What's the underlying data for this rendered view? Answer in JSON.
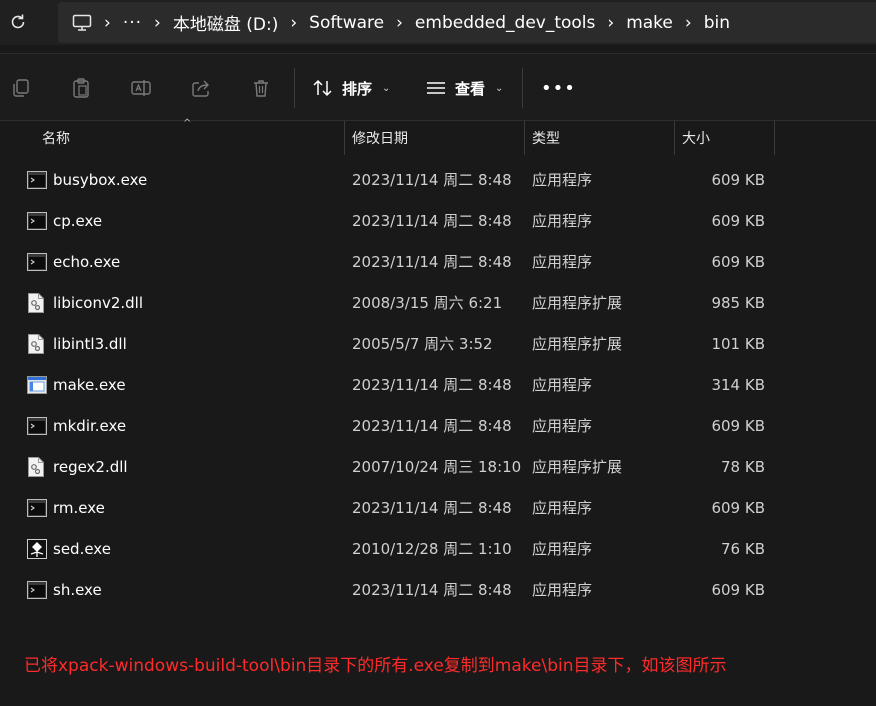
{
  "address_bar": {
    "refresh_icon": "refresh-icon",
    "pc_icon": "this-pc-icon",
    "overflow": "···",
    "crumbs": [
      "本地磁盘 (D:)",
      "Software",
      "embedded_dev_tools",
      "make",
      "bin"
    ]
  },
  "toolbar": {
    "icons": [
      "copy-icon",
      "paste-icon",
      "rename-icon",
      "share-icon",
      "delete-icon"
    ],
    "sort_label": "排序",
    "view_label": "查看",
    "more": "•••"
  },
  "columns": {
    "name": "名称",
    "date": "修改日期",
    "type": "类型",
    "size": "大小"
  },
  "files": [
    {
      "name": "busybox.exe",
      "date": "2023/11/14 周二 8:48",
      "type": "应用程序",
      "size": "609 KB",
      "icon": "console-exe-icon"
    },
    {
      "name": "cp.exe",
      "date": "2023/11/14 周二 8:48",
      "type": "应用程序",
      "size": "609 KB",
      "icon": "console-exe-icon"
    },
    {
      "name": "echo.exe",
      "date": "2023/11/14 周二 8:48",
      "type": "应用程序",
      "size": "609 KB",
      "icon": "console-exe-icon"
    },
    {
      "name": "libiconv2.dll",
      "date": "2008/3/15 周六 6:21",
      "type": "应用程序扩展",
      "size": "985 KB",
      "icon": "dll-file-icon"
    },
    {
      "name": "libintl3.dll",
      "date": "2005/5/7 周六 3:52",
      "type": "应用程序扩展",
      "size": "101 KB",
      "icon": "dll-file-icon"
    },
    {
      "name": "make.exe",
      "date": "2023/11/14 周二 8:48",
      "type": "应用程序",
      "size": "314 KB",
      "icon": "window-exe-icon"
    },
    {
      "name": "mkdir.exe",
      "date": "2023/11/14 周二 8:48",
      "type": "应用程序",
      "size": "609 KB",
      "icon": "console-exe-icon"
    },
    {
      "name": "regex2.dll",
      "date": "2007/10/24 周三 18:10",
      "type": "应用程序扩展",
      "size": "78 KB",
      "icon": "dll-file-icon"
    },
    {
      "name": "rm.exe",
      "date": "2023/11/14 周二 8:48",
      "type": "应用程序",
      "size": "609 KB",
      "icon": "console-exe-icon"
    },
    {
      "name": "sed.exe",
      "date": "2010/12/28 周二 1:10",
      "type": "应用程序",
      "size": "76 KB",
      "icon": "sed-app-icon"
    },
    {
      "name": "sh.exe",
      "date": "2023/11/14 周二 8:48",
      "type": "应用程序",
      "size": "609 KB",
      "icon": "console-exe-icon"
    }
  ],
  "annotation": "已将xpack-windows-build-tool\\bin目录下的所有.exe复制到make\\bin目录下，如该图所示",
  "colors": {
    "background": "#191919",
    "annotation_text": "#ff2a2a"
  }
}
